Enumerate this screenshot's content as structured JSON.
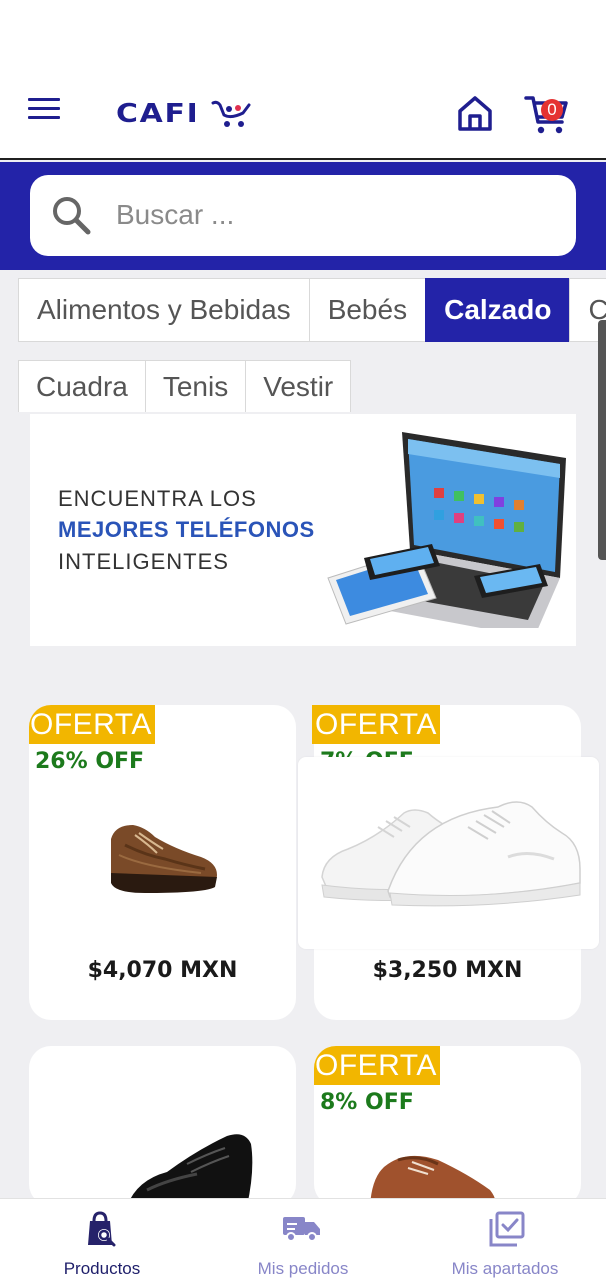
{
  "header": {
    "logo_text": "CAFI",
    "cart_count": "0"
  },
  "search": {
    "placeholder": "Buscar ..."
  },
  "categories": [
    {
      "label": "Alimentos y Bebidas",
      "active": false
    },
    {
      "label": "Bebés",
      "active": false
    },
    {
      "label": "Calzado",
      "active": true
    },
    {
      "label": "Ce",
      "active": false
    }
  ],
  "subcategories": [
    {
      "label": "Cuadra"
    },
    {
      "label": "Tenis"
    },
    {
      "label": "Vestir"
    }
  ],
  "banner": {
    "line1": "ENCUENTRA LOS",
    "line2": "MEJORES TELÉFONOS",
    "line3": "INTELIGENTES"
  },
  "products": [
    {
      "badge": "OFERTA",
      "discount": "26% OFF",
      "price": "$4,070 MXN",
      "image": "brown-leather-oxford-shoe"
    },
    {
      "badge": "OFERTA",
      "discount": "7% OFF",
      "price": "$3,250 MXN",
      "image": "white-sneakers"
    },
    {
      "badge": "",
      "discount": "",
      "price": "",
      "image": "black-dress-shoe"
    },
    {
      "badge": "OFERTA",
      "discount": "8% OFF",
      "price": "",
      "image": "brown-derby-shoe"
    }
  ],
  "bottom_nav": [
    {
      "label": "Productos",
      "icon": "shopping-bag-search-icon",
      "active": true
    },
    {
      "label": "Mis pedidos",
      "icon": "delivery-truck-icon",
      "active": false
    },
    {
      "label": "Mis apartados",
      "icon": "calendar-check-icon",
      "active": false
    }
  ],
  "colors": {
    "brand_blue": "#2323a8",
    "logo_blue": "#1f1e8f",
    "offer_yellow": "#f2b600",
    "discount_green": "#1c7a1c",
    "badge_red": "#e53232"
  }
}
